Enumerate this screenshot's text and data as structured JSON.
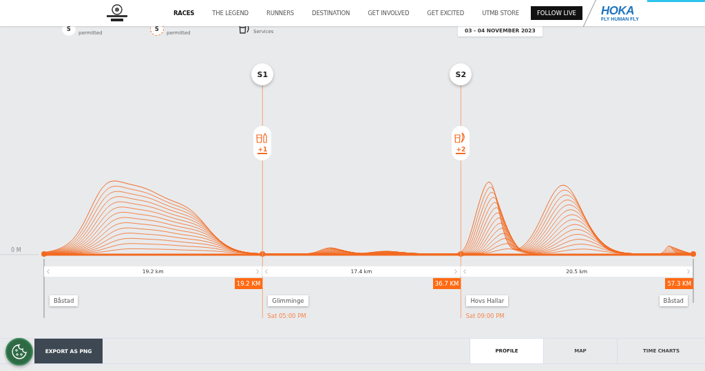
{
  "header": {
    "brand_tagline": "FLY HUMAN FLY",
    "brand": "HOKA",
    "nav": [
      {
        "label": "RACES",
        "selected": true
      },
      {
        "label": "THE LEGEND",
        "selected": false
      },
      {
        "label": "RUNNERS",
        "selected": false
      },
      {
        "label": "DESTINATION",
        "selected": false
      },
      {
        "label": "GET INVOLVED",
        "selected": false
      },
      {
        "label": "GET EXCITED",
        "selected": false
      },
      {
        "label": "UTMB STORE",
        "selected": false
      }
    ],
    "follow_button": "FOLLOW LIVE",
    "date": "03 - 04 NOVEMBER 2023"
  },
  "legend": [
    {
      "kind": "solid",
      "symbol": "S",
      "text": "permitted"
    },
    {
      "kind": "dashed",
      "symbol": "S",
      "text": "permitted"
    },
    {
      "kind": "icon",
      "text": "Services"
    }
  ],
  "profile": {
    "y_label": "0 M",
    "stations": [
      {
        "label": "S1",
        "services": "+1",
        "kind": "bottle"
      },
      {
        "label": "S2",
        "services": "+2",
        "kind": "banana"
      }
    ],
    "segments": [
      {
        "distance": "19.2 km"
      },
      {
        "distance": "17.4 km"
      },
      {
        "distance": "20.5 km"
      }
    ],
    "km_markers": [
      "19.2 KM",
      "36.7 KM",
      "57.3 KM"
    ],
    "locations": [
      {
        "name": "Båstad"
      },
      {
        "name": "Glimminge",
        "time": "Sat 05:00 PM"
      },
      {
        "name": "Hovs Hallar",
        "time": "Sat 09:00 PM"
      },
      {
        "name": "Båstad"
      }
    ]
  },
  "footer": {
    "export_button": "EXPORT AS PNG",
    "tabs": [
      {
        "label": "PROFILE",
        "selected": true
      },
      {
        "label": "MAP",
        "selected": false
      },
      {
        "label": "TIME CHARTS",
        "selected": false
      }
    ]
  }
}
